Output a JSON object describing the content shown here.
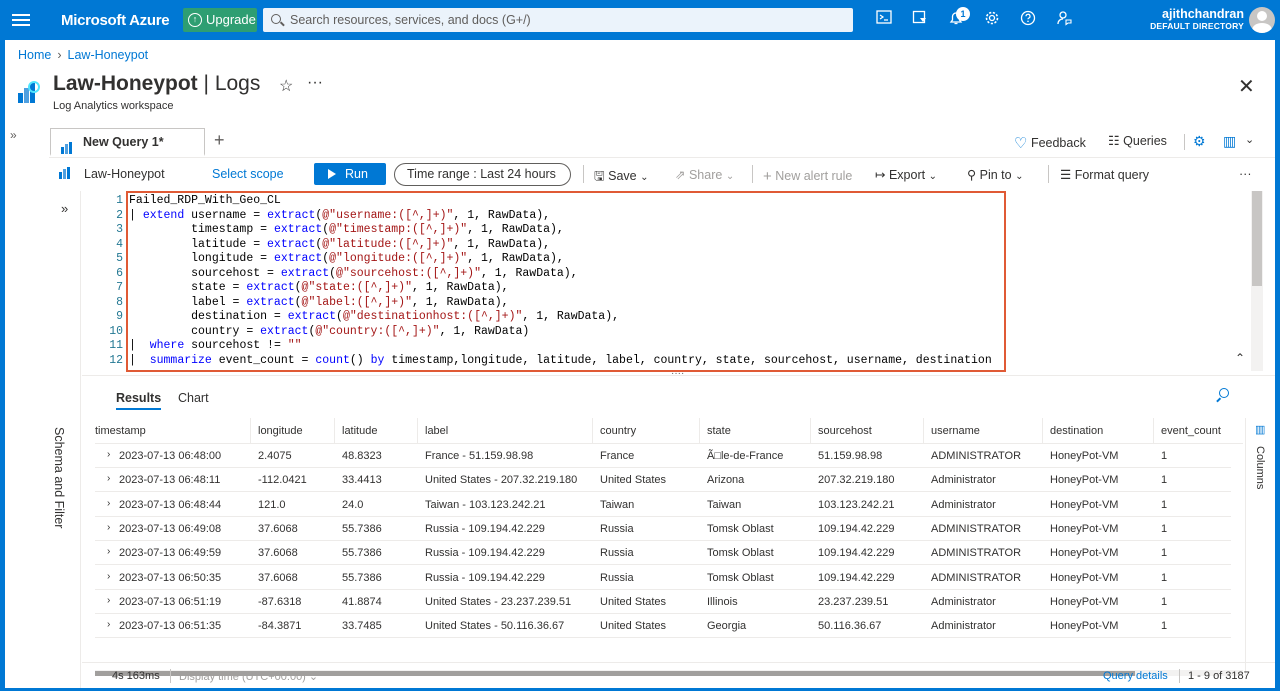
{
  "topbar": {
    "brand": "Microsoft Azure",
    "upgrade_label": "Upgrade",
    "search_placeholder": "Search resources, services, and docs (G+/)",
    "notification_count": "1",
    "user_name": "ajithchandran",
    "user_directory": "DEFAULT DIRECTORY",
    "icons": [
      "cloud-shell-icon",
      "directory-filter-icon",
      "notifications-icon",
      "settings-icon",
      "help-icon",
      "feedback-icon"
    ]
  },
  "breadcrumb": {
    "home": "Home",
    "current": "Law-Honeypot"
  },
  "page": {
    "title": "Law-Honeypot",
    "title_suffix": "Logs",
    "subtitle": "Log Analytics workspace"
  },
  "tabs": {
    "active": "New Query 1*",
    "feedback": "Feedback",
    "queries": "Queries"
  },
  "toolbar": {
    "scope": "Law-Honeypot",
    "select_scope": "Select scope",
    "run": "Run",
    "time_range_label": "Time range :",
    "time_range_value": "Last 24 hours",
    "save": "Save",
    "share": "Share",
    "new_alert": "New alert rule",
    "export": "Export",
    "pin": "Pin to",
    "format": "Format query"
  },
  "side_panel": {
    "label": "Schema and Filter"
  },
  "editor": {
    "line_numbers": [
      "1",
      "2",
      "3",
      "4",
      "5",
      "6",
      "7",
      "8",
      "9",
      "10",
      "11",
      "12"
    ],
    "lines": [
      "Failed_RDP_With_Geo_CL",
      "| extend username = extract(@\"username:([^,]+)\", 1, RawData),",
      "         timestamp = extract(@\"timestamp:([^,]+)\", 1, RawData),",
      "         latitude = extract(@\"latitude:([^,]+)\", 1, RawData),",
      "         longitude = extract(@\"longitude:([^,]+)\", 1, RawData),",
      "         sourcehost = extract(@\"sourcehost:([^,]+)\", 1, RawData),",
      "         state = extract(@\"state:([^,]+)\", 1, RawData),",
      "         label = extract(@\"label:([^,]+)\", 1, RawData),",
      "         destination = extract(@\"destinationhost:([^,]+)\", 1, RawData),",
      "         country = extract(@\"country:([^,]+)\", 1, RawData)",
      "|  where sourcehost != \"\"",
      "|  summarize event_count = count() by timestamp,longitude, latitude, label, country, state, sourcehost, username, destination"
    ]
  },
  "results": {
    "tab_results": "Results",
    "tab_chart": "Chart",
    "columns_label": "Columns",
    "headers": [
      "timestamp",
      "longitude",
      "latitude",
      "label",
      "country",
      "state",
      "sourcehost",
      "username",
      "destination",
      "event_count"
    ],
    "rows": [
      [
        "2023-07-13 06:48:00",
        "2.4075",
        "48.8323",
        "France - 51.159.98.98",
        "France",
        "Ã□le-de-France",
        "51.159.98.98",
        "ADMINISTRATOR",
        "HoneyPot-VM",
        "1"
      ],
      [
        "2023-07-13 06:48:11",
        "-112.0421",
        "33.4413",
        "United States - 207.32.219.180",
        "United States",
        "Arizona",
        "207.32.219.180",
        "Administrator",
        "HoneyPot-VM",
        "1"
      ],
      [
        "2023-07-13 06:48:44",
        "121.0",
        "24.0",
        "Taiwan - 103.123.242.21",
        "Taiwan",
        "Taiwan",
        "103.123.242.21",
        "Administrator",
        "HoneyPot-VM",
        "1"
      ],
      [
        "2023-07-13 06:49:08",
        "37.6068",
        "55.7386",
        "Russia - 109.194.42.229",
        "Russia",
        "Tomsk Oblast",
        "109.194.42.229",
        "ADMINISTRATOR",
        "HoneyPot-VM",
        "1"
      ],
      [
        "2023-07-13 06:49:59",
        "37.6068",
        "55.7386",
        "Russia - 109.194.42.229",
        "Russia",
        "Tomsk Oblast",
        "109.194.42.229",
        "ADMINISTRATOR",
        "HoneyPot-VM",
        "1"
      ],
      [
        "2023-07-13 06:50:35",
        "37.6068",
        "55.7386",
        "Russia - 109.194.42.229",
        "Russia",
        "Tomsk Oblast",
        "109.194.42.229",
        "ADMINISTRATOR",
        "HoneyPot-VM",
        "1"
      ],
      [
        "2023-07-13 06:51:19",
        "-87.6318",
        "41.8874",
        "United States - 23.237.239.51",
        "United States",
        "Illinois",
        "23.237.239.51",
        "Administrator",
        "HoneyPot-VM",
        "1"
      ],
      [
        "2023-07-13 06:51:35",
        "-84.3871",
        "33.7485",
        "United States - 50.116.36.67",
        "United States",
        "Georgia",
        "50.116.36.67",
        "Administrator",
        "HoneyPot-VM",
        "1"
      ]
    ]
  },
  "status": {
    "duration": "4s 163ms",
    "display_time": "Display time (UTC+00:00)",
    "query_details": "Query details",
    "count": "1 - 9 of 3187"
  }
}
